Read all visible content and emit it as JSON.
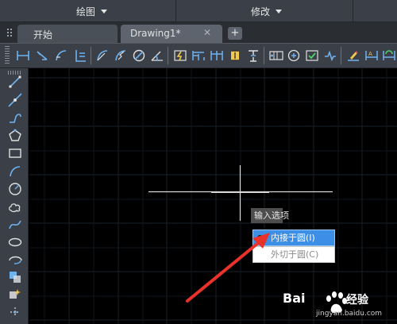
{
  "ribbon": {
    "panels": [
      {
        "label": "绘图"
      },
      {
        "label": "修改"
      }
    ]
  },
  "tabs": {
    "start": "开始",
    "drawing": "Drawing1*",
    "close": "✕",
    "add": "+"
  },
  "dynamic_input": {
    "title": "输入选项",
    "options": [
      {
        "label": "内接于圆(I)",
        "selected": true
      },
      {
        "label": "外切于圆(C)",
        "selected": false
      }
    ]
  },
  "watermark": {
    "brand": "Bai",
    "brand2": "经验",
    "url": "jingyan.baidu.com"
  },
  "colors": {
    "selected_option": "#3d8ee5",
    "arrow": "#e8322a",
    "grid": "#1f2a36",
    "crosshair": "#d8d8d8"
  },
  "icons": {
    "toolbar": [
      "linear-dimension-icon",
      "aligned-dimension-icon",
      "arc-length-icon",
      "ordinate-dimension-icon",
      "radius-dimension-icon",
      "jogged-icon",
      "diameter-icon",
      "angular-icon",
      "quick-dimension-icon",
      "baseline-icon",
      "continue-icon",
      "dimension-space-icon",
      "dimension-break-icon",
      "tolerance-icon",
      "center-mark-icon",
      "inspection-icon",
      "jogged-linear-icon",
      "dimension-edit-icon",
      "dimension-text-edit-icon",
      "dimension-update-icon"
    ],
    "left": [
      "line-icon",
      "construction-line-icon",
      "polyline-icon",
      "polygon-icon",
      "rectangle-icon",
      "arc-icon",
      "circle-icon",
      "revision-cloud-icon",
      "spline-icon",
      "ellipse-icon",
      "ellipse-arc-icon",
      "insert-block-icon",
      "make-block-icon",
      "point-icon"
    ]
  }
}
